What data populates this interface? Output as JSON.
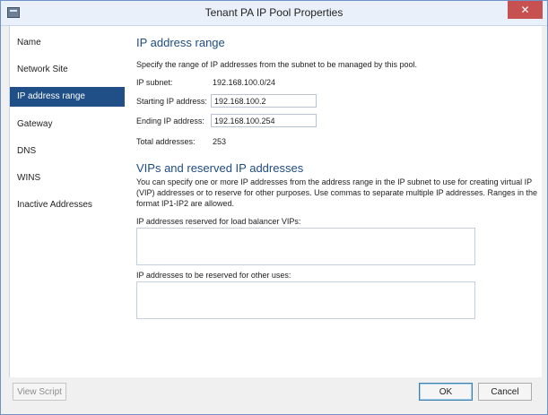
{
  "window": {
    "title": "Tenant PA IP Pool Properties",
    "close_glyph": "✕"
  },
  "sidebar": {
    "items": [
      {
        "label": "Name"
      },
      {
        "label": "Network Site"
      },
      {
        "label": "IP address range",
        "selected": true
      },
      {
        "label": "Gateway"
      },
      {
        "label": "DNS"
      },
      {
        "label": "WINS"
      },
      {
        "label": "Inactive Addresses"
      }
    ]
  },
  "main": {
    "heading": "IP address range",
    "description": "Specify the range of IP addresses from the subnet to be managed by this pool.",
    "subnet_label": "IP subnet:",
    "subnet_value": "192.168.100.0/24",
    "start_label": "Starting IP address:",
    "start_value": "192.168.100.2",
    "end_label": "Ending IP address:",
    "end_value": "192.168.100.254",
    "total_label": "Total addresses:",
    "total_value": "253",
    "vip_heading": "VIPs and reserved IP addresses",
    "vip_description": "You can specify one or more IP addresses from the address range in the IP subnet to use for creating virtual IP (VIP) addresses or to reserve for other purposes. Use commas to separate multiple IP addresses. Ranges in the format IP1-IP2 are allowed.",
    "vip_field_label": "IP addresses reserved for load balancer VIPs:",
    "vip_field_value": "",
    "other_field_label": "IP addresses to be reserved for other uses:",
    "other_field_value": ""
  },
  "footer": {
    "view_script_label": "View Script",
    "ok_label": "OK",
    "cancel_label": "Cancel"
  },
  "colors": {
    "accent": "#1f4f86",
    "heading": "#1e4c82",
    "close": "#c75050"
  }
}
